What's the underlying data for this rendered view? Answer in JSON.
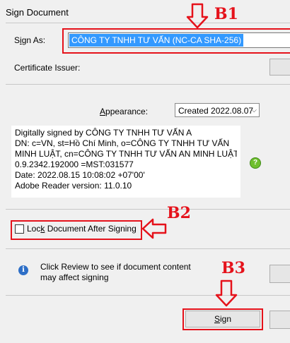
{
  "window": {
    "title": "Sign Document"
  },
  "sign_as": {
    "label_pre": "S",
    "label_ul": "i",
    "label_post": "gn As:",
    "value": "CÔNG TY TNHH TƯ VẤN            (NC-CA SHA-256)"
  },
  "certificate_issuer": {
    "label": "Certificate Issuer:"
  },
  "appearance": {
    "label_pre": "",
    "label_ul": "A",
    "label_post": "ppearance:",
    "selected": "Created 2022.08.07"
  },
  "preview_lines": [
    "Digitally signed by CÔNG TY TNHH TƯ VẤN A",
    "DN: c=VN, st=Hồ Chí Minh, o=CÔNG TY TNHH TƯ VẤN",
    "MINH LUẬT, cn=CÔNG TY TNHH TƯ VẤN AN MINH LUẬT,",
    "0.9.2342.192000          =MST:031577",
    "Date: 2022.08.15 10:08:02 +07'00'",
    "Adobe Reader version: 11.0.10"
  ],
  "lock_document": {
    "label_pre": "Loc",
    "label_ul": "k",
    "label_post": " Document After Signing",
    "checked": false
  },
  "review_notice": {
    "line1": "Click Review to see if document content",
    "line2": "may affect signing"
  },
  "sign_button": {
    "label_pre": "",
    "label_ul": "S",
    "label_post": "ign"
  },
  "annotations": {
    "b1": "B1",
    "b2": "B2",
    "b3": "B3",
    "arrow_color": "#e5121b"
  },
  "colors": {
    "selection": "#3399ff",
    "dialog_bg": "#f0f0f0",
    "verified_icon": "#6fbf2e",
    "info_icon": "#2e6fc7"
  }
}
